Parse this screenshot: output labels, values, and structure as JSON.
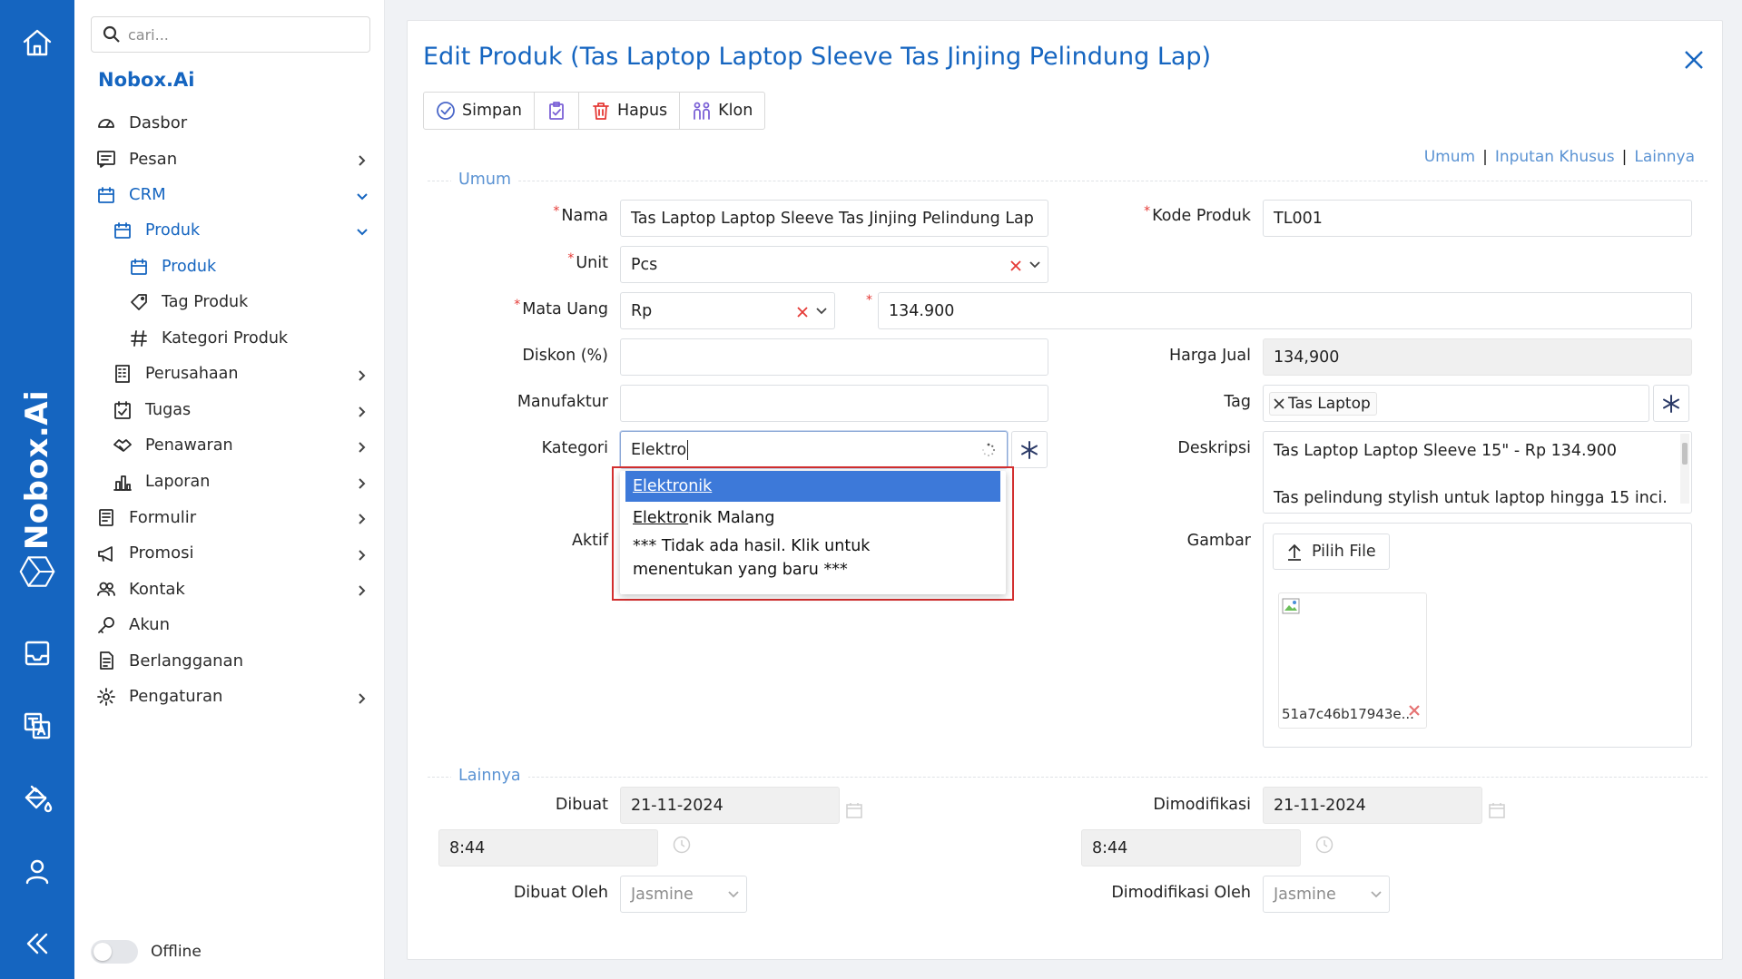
{
  "rail": {
    "brand": "Nobox.Ai"
  },
  "sidebar": {
    "search_placeholder": "cari...",
    "brand": "Nobox.Ai",
    "items": [
      {
        "label": "Dasbor",
        "icon": "dashboard-icon"
      },
      {
        "label": "Pesan",
        "icon": "message-icon"
      },
      {
        "label": "CRM",
        "icon": "crm-icon"
      },
      {
        "label": "Produk",
        "icon": "product-icon"
      },
      {
        "label": "Produk",
        "icon": "product-icon"
      },
      {
        "label": "Tag Produk",
        "icon": "tag-icon"
      },
      {
        "label": "Kategori Produk",
        "icon": "hash-icon"
      },
      {
        "label": "Perusahaan",
        "icon": "building-icon"
      },
      {
        "label": "Tugas",
        "icon": "task-icon"
      },
      {
        "label": "Penawaran",
        "icon": "handshake-icon"
      },
      {
        "label": "Laporan",
        "icon": "report-icon"
      },
      {
        "label": "Formulir",
        "icon": "form-icon"
      },
      {
        "label": "Promosi",
        "icon": "megaphone-icon"
      },
      {
        "label": "Kontak",
        "icon": "contacts-icon"
      },
      {
        "label": "Akun",
        "icon": "key-icon"
      },
      {
        "label": "Berlangganan",
        "icon": "subscription-icon"
      },
      {
        "label": "Pengaturan",
        "icon": "settings-icon"
      }
    ],
    "offline_label": "Offline"
  },
  "page": {
    "title": "Edit Produk (Tas Laptop Laptop Sleeve Tas Jinjing Pelindung Lap)",
    "toolbar": {
      "save": "Simpan",
      "delete": "Hapus",
      "clone": "Klon"
    },
    "anchors": [
      "Umum",
      "Inputan Khusus",
      "Lainnya"
    ],
    "section_general": "Umum",
    "section_other": "Lainnya"
  },
  "form": {
    "name_label": "Nama",
    "name_value": "Tas Laptop Laptop Sleeve Tas Jinjing Pelindung Lap",
    "code_label": "Kode Produk",
    "code_value": "TL001",
    "unit_label": "Unit",
    "unit_value": "Pcs",
    "currency_label": "Mata Uang",
    "currency_value": "Rp",
    "price_value": "134.900",
    "discount_label": "Diskon (%)",
    "discount_value": "",
    "sell_price_label": "Harga Jual",
    "sell_price_value": "134,900",
    "manufacturer_label": "Manufaktur",
    "manufacturer_value": "",
    "tag_label": "Tag",
    "tag_chip": "Tas Laptop",
    "category_label": "Kategori",
    "category_value": "Elektro",
    "description_label": "Deskripsi",
    "description_line1": "Tas Laptop Laptop Sleeve 15\" - Rp 134.900",
    "description_line2": "Tas pelindung stylish untuk laptop hingga 15 inci.",
    "active_label": "Aktif",
    "image_label": "Gambar",
    "choose_file": "Pilih File",
    "file_name": "51a7c46b17943e...",
    "created_label": "Dibuat",
    "created_date": "21-11-2024",
    "created_time": "8:44",
    "modified_label": "Dimodifikasi",
    "modified_date": "21-11-2024",
    "modified_time": "8:44",
    "created_by_label": "Dibuat Oleh",
    "created_by_value": "Jasmine",
    "modified_by_label": "Dimodifikasi Oleh",
    "modified_by_value": "Jasmine"
  },
  "dropdown": {
    "options": [
      {
        "match": "Elektro",
        "rest": "nik"
      },
      {
        "match": "Elektro",
        "rest": "nik Malang"
      }
    ],
    "no_result": "*** Tidak ada hasil. Klik untuk menentukan yang baru ***"
  },
  "colors": {
    "primary": "#1565c0",
    "required": "#e53935",
    "highlight": "#d32f2f",
    "selected": "#3d79d9"
  }
}
